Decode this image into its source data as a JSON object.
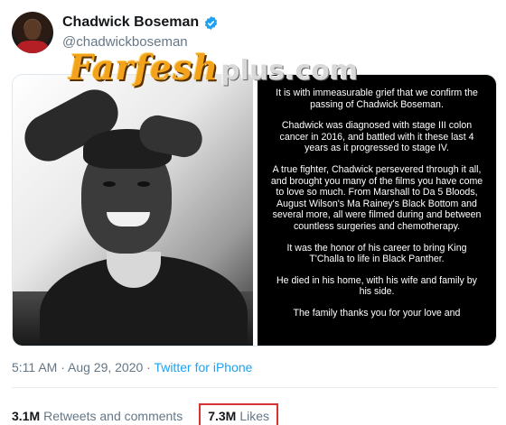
{
  "author": {
    "display_name": "Chadwick Boseman",
    "handle": "@chadwickboseman"
  },
  "watermark": {
    "main": "Farfesh",
    "sub": "plus.com"
  },
  "statement": {
    "paragraphs": [
      "It is with immeasurable grief that we confirm the passing of Chadwick Boseman.",
      "Chadwick was diagnosed with stage III colon cancer in 2016, and battled with it these last 4 years as it progressed to stage IV.",
      "A true fighter, Chadwick persevered through it all, and brought you many of the films you have come to love so much. From Marshall to Da 5 Bloods, August Wilson's Ma Rainey's Black Bottom and several more, all were filmed during and between countless surgeries and chemotherapy.",
      "It was the honor of his career to bring King T'Challa to life in Black Panther.",
      "He died in his home, with his wife and family by his side.",
      "The family thanks you for your love and"
    ]
  },
  "timestamp": {
    "time_date": "5:11 AM · Aug 29, 2020 · ",
    "source": "Twitter for iPhone"
  },
  "stats": {
    "retweets_count": "3.1M",
    "retweets_label": "Retweets and comments",
    "likes_count": "7.3M",
    "likes_label": "Likes"
  },
  "colors": {
    "accent": "#1da1f2",
    "highlight_box": "#d93030",
    "secondary_text": "#657786"
  }
}
